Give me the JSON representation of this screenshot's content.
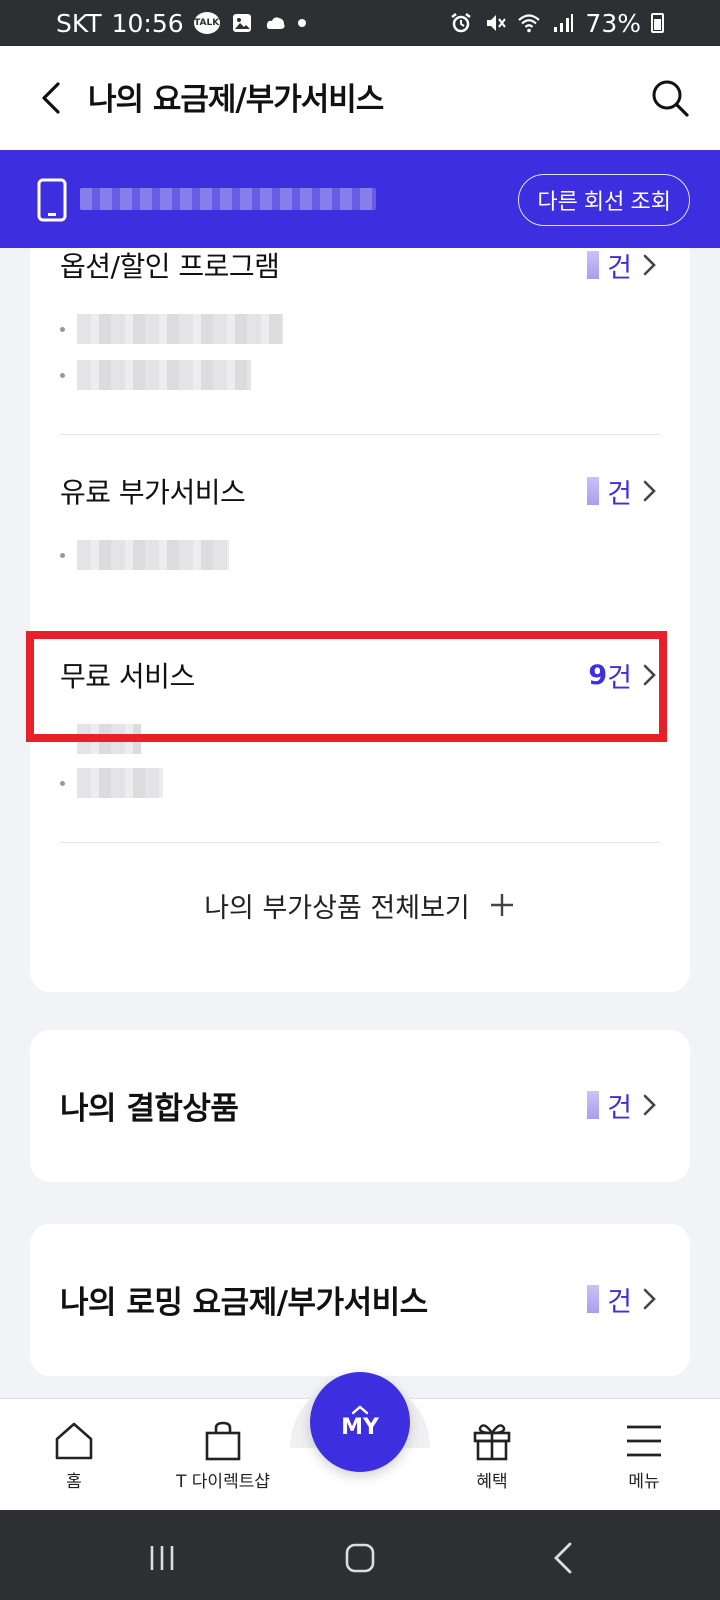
{
  "status_bar": {
    "carrier": "SKT",
    "time": "10:56",
    "talk_badge": "TALK",
    "battery": "73%"
  },
  "header": {
    "title": "나의 요금제/부가서비스"
  },
  "line_bar": {
    "other_line_button": "다른 회선 조회"
  },
  "sections": {
    "options": {
      "title": "옵션/할인 프로그램",
      "count_suffix": "건"
    },
    "paid": {
      "title": "유료 부가서비스",
      "count_suffix": "건"
    },
    "free": {
      "title": "무료 서비스",
      "count": "9",
      "count_suffix": "건"
    },
    "view_all": "나의 부가상품 전체보기"
  },
  "cards": {
    "bundle": {
      "title": "나의 결합상품",
      "count_suffix": "건"
    },
    "roaming": {
      "title": "나의 로밍 요금제/부가서비스",
      "count_suffix": "건"
    }
  },
  "bottom_nav": {
    "home": "홈",
    "direct_shop": "T 다이렉트샵",
    "my": "MY",
    "benefits": "혜택",
    "menu": "메뉴"
  },
  "colors": {
    "accent": "#3d2fe0",
    "highlight": "#e8202a"
  }
}
